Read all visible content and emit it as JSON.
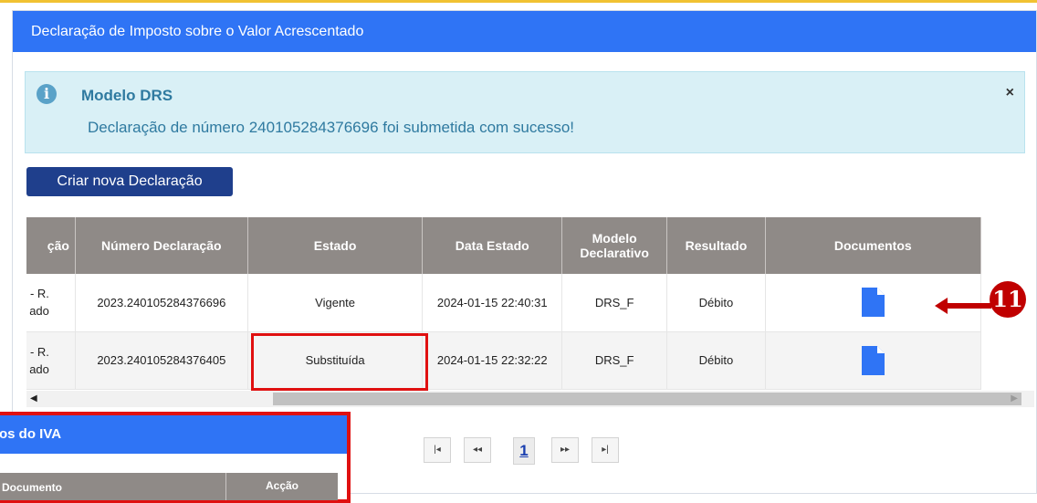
{
  "panel": {
    "title": "Declaração de Imposto sobre o Valor Acrescentado"
  },
  "alert": {
    "icon": "info-icon",
    "title": "Modelo DRS",
    "message": "Declaração de número 240105284376696 foi submetida com sucesso!",
    "close_label": "×"
  },
  "actions": {
    "create_label": "Criar nova Declaração"
  },
  "table": {
    "headers": {
      "situacao": "ção",
      "numero": "Número Declaração",
      "estado": "Estado",
      "data": "Data Estado",
      "modelo": "Modelo Declarativo",
      "resultado": "Resultado",
      "documentos": "Documentos"
    },
    "rows": [
      {
        "situacao_1": "- R.",
        "situacao_2": "ado",
        "numero": "2023.240105284376696",
        "estado": "Vigente",
        "data": "2024-01-15 22:40:31",
        "modelo": "DRS_F",
        "resultado": "Débito",
        "doc_icon": "document-icon"
      },
      {
        "situacao_1": "- R.",
        "situacao_2": "ado",
        "numero": "2023.240105284376405",
        "estado": "Substituída",
        "data": "2024-01-15 22:32:22",
        "modelo": "DRS_F",
        "resultado": "Débito",
        "doc_icon": "document-icon"
      }
    ]
  },
  "annotation": {
    "badge": "11",
    "color": "#c00000"
  },
  "pager": {
    "first": "|◂",
    "prev": "◂◂",
    "current": "1",
    "next": "▸▸",
    "last": "▸|"
  },
  "overlay": {
    "title": "tos do IVA",
    "col_document": "Documento",
    "col_action": "Acção"
  },
  "colors": {
    "header_blue": "#2f74f5",
    "button_navy": "#1f3f8c",
    "table_header": "#8f8a87",
    "highlight_red": "#e01010"
  }
}
